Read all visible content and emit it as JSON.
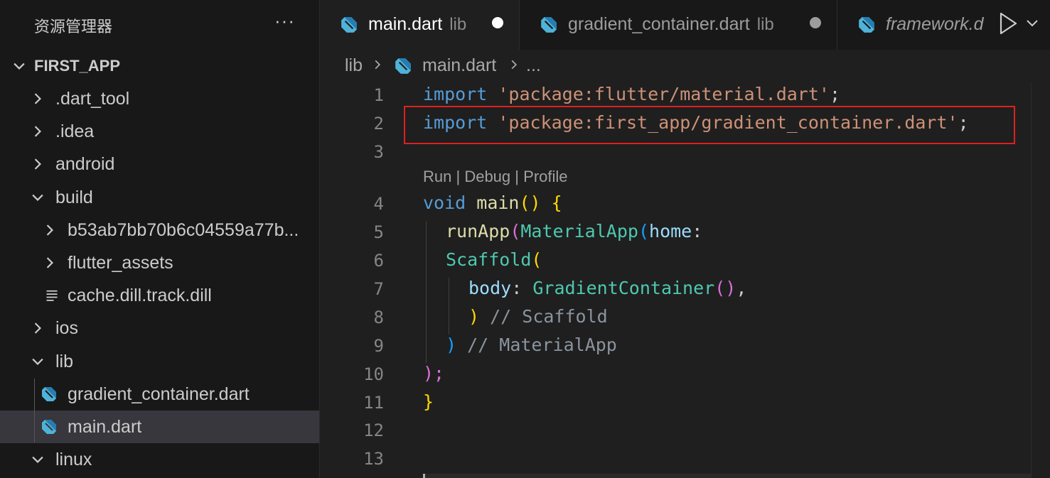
{
  "sidebar": {
    "title": "资源管理器",
    "more_label": "···",
    "root": "FIRST_APP",
    "items": [
      {
        "label": ".dart_tool"
      },
      {
        "label": ".idea"
      },
      {
        "label": "android"
      },
      {
        "label": "build"
      },
      {
        "label": "b53ab7bb70b6c04559a77b..."
      },
      {
        "label": "flutter_assets"
      },
      {
        "label": "cache.dill.track.dill"
      },
      {
        "label": "ios"
      },
      {
        "label": "lib"
      },
      {
        "label": "gradient_container.dart"
      },
      {
        "label": "main.dart"
      },
      {
        "label": "linux"
      }
    ]
  },
  "tabs": [
    {
      "name": "main.dart",
      "dir": "lib"
    },
    {
      "name": "gradient_container.dart",
      "dir": "lib"
    },
    {
      "name": "framework.d",
      "dir": ""
    }
  ],
  "breadcrumb": {
    "dir": "lib",
    "file": "main.dart",
    "more": "..."
  },
  "editor": {
    "line_numbers": [
      "1",
      "2",
      "3",
      "4",
      "5",
      "6",
      "7",
      "8",
      "9",
      "10",
      "11",
      "12",
      "13"
    ],
    "codelens": {
      "run": "Run",
      "debug": "Debug",
      "profile": "Profile",
      "sep": "|"
    },
    "tokens": {
      "import": "import",
      "pkg_material": "'package:flutter/material.dart'",
      "pkg_gradient": "'package:first_app/gradient_container.dart'",
      "semi": ";",
      "void": "void",
      "main": "main",
      "parens": "()",
      "brace_open": "{",
      "runApp": "runApp",
      "paren_open": "(",
      "MaterialApp": "MaterialApp",
      "home": "home",
      "colon": ":",
      "Scaffold": "Scaffold",
      "body": "body",
      "GradientContainer": "GradientContainer",
      "comma": ",",
      "paren_close": ")",
      "comment_scaffold": "// Scaffold",
      "comment_materialapp": "// MaterialApp",
      "close_semi": ");",
      "brace_close": "}"
    }
  },
  "colors": {
    "highlight_box": "#e02020",
    "dart_icon": "#4fb3d9",
    "keyword": "#569cd6",
    "string": "#ce9178",
    "class": "#4ec9b0"
  }
}
